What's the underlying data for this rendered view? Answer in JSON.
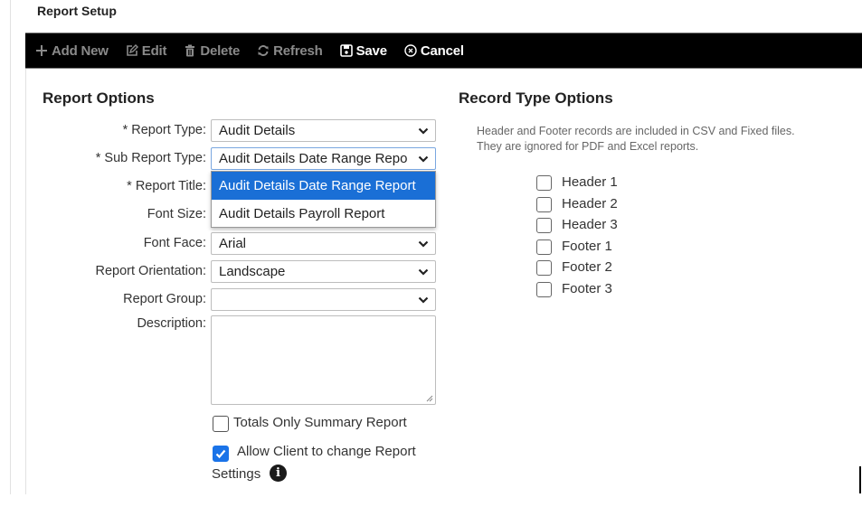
{
  "page": {
    "title": "Report Setup"
  },
  "toolbar": {
    "buttons": [
      {
        "label": "Add New",
        "icon": "plus-icon",
        "enabled": false
      },
      {
        "label": "Edit",
        "icon": "edit-icon",
        "enabled": false
      },
      {
        "label": "Delete",
        "icon": "trash-icon",
        "enabled": false
      },
      {
        "label": "Refresh",
        "icon": "refresh-icon",
        "enabled": false
      },
      {
        "label": "Save",
        "icon": "save-icon",
        "enabled": true
      },
      {
        "label": "Cancel",
        "icon": "cancel-circle-icon",
        "enabled": true
      }
    ]
  },
  "report_options": {
    "title": "Report Options",
    "fields": {
      "report_type": {
        "label": "* Report Type:",
        "value": "Audit Details"
      },
      "sub_report_type": {
        "label": "* Sub Report Type:",
        "value": "Audit Details Date Range Repo",
        "dropdown_open": true,
        "options": [
          "Audit Details Date Range Report",
          "Audit Details Payroll Report"
        ],
        "selected_option": "Audit Details Date Range Report"
      },
      "report_title": {
        "label": "* Report Title:",
        "value": ""
      },
      "font_size": {
        "label": "Font Size:",
        "value": ""
      },
      "font_face": {
        "label": "Font Face:",
        "value": "Arial"
      },
      "report_orientation": {
        "label": "Report Orientation:",
        "value": "Landscape"
      },
      "report_group": {
        "label": "Report Group:",
        "value": ""
      },
      "description": {
        "label": "Description:",
        "value": ""
      }
    },
    "totals_only": {
      "label": "Totals Only Summary Report",
      "checked": false
    },
    "allow_client_change": {
      "label_line1": "Allow Client to change Report",
      "label_line2": "Settings",
      "checked": true,
      "info_icon": "info-icon"
    }
  },
  "record_type_options": {
    "title": "Record Type Options",
    "description_line1": "Header and Footer records are included in CSV and Fixed files.",
    "description_line2": "They are ignored for PDF and Excel reports.",
    "items": [
      {
        "label": "Header 1",
        "checked": false
      },
      {
        "label": "Header 2",
        "checked": false
      },
      {
        "label": "Header 3",
        "checked": false
      },
      {
        "label": "Footer 1",
        "checked": false
      },
      {
        "label": "Footer 2",
        "checked": false
      },
      {
        "label": "Footer 3",
        "checked": false
      }
    ]
  },
  "colors": {
    "toolbar_bg": "#000000",
    "toolbar_disabled": "#8a8a8a",
    "toolbar_enabled": "#ffffff",
    "accent": "#1a6fd6",
    "checkbox_checked": "#1a73e8"
  }
}
